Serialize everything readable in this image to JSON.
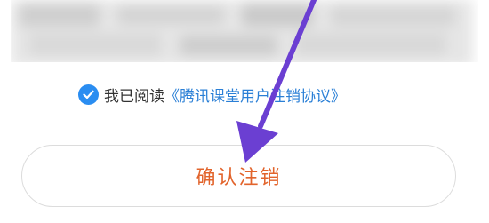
{
  "agreement": {
    "checked": true,
    "prefix": "我已阅读",
    "link_text": "《腾讯课堂用户注销协议》"
  },
  "confirm_button": {
    "label": "确认注销"
  },
  "colors": {
    "checkbox": "#2a8df1",
    "link": "#2a7fd6",
    "confirm_text": "#e2642c",
    "annotation_arrow": "#6b3fd2"
  },
  "annotation": {
    "icon": "arrow-icon"
  }
}
